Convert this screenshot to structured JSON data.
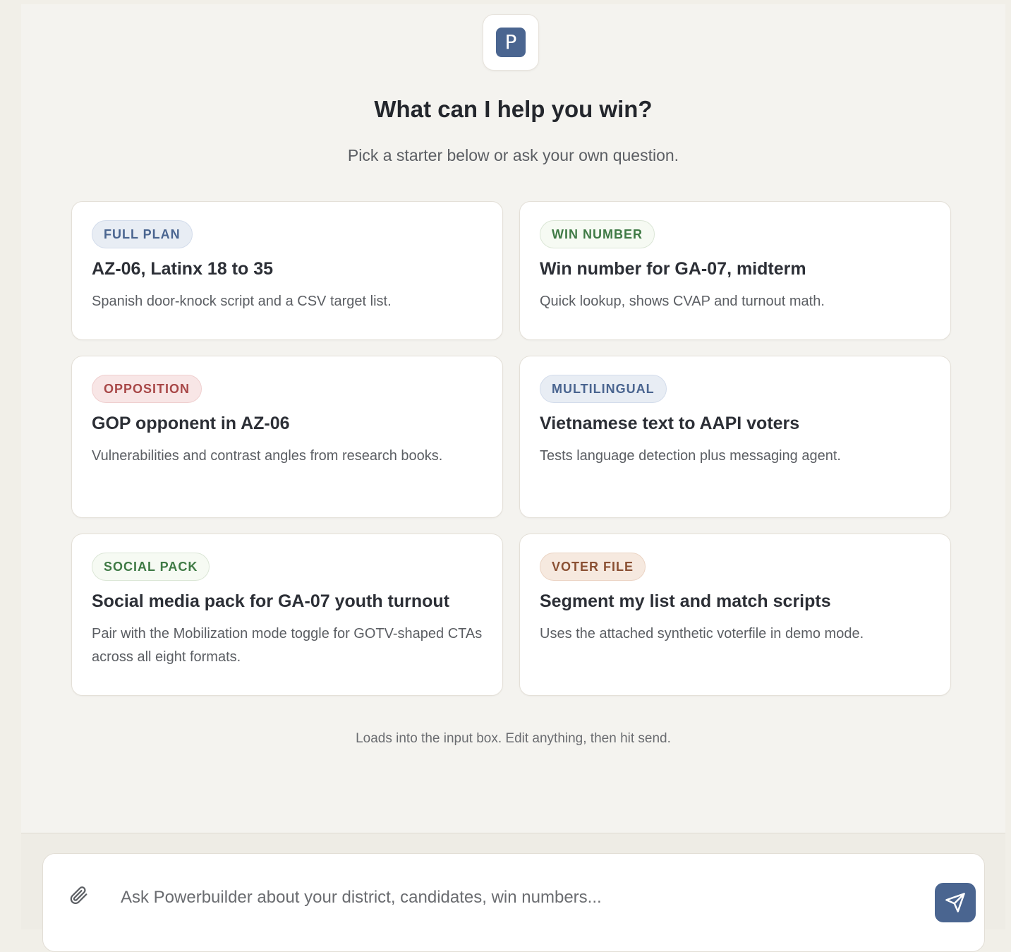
{
  "logo": {
    "letter": "P"
  },
  "hero": {
    "title": "What can I help you win?",
    "subtitle": "Pick a starter below or ask your own question."
  },
  "starters": [
    {
      "tag": "FULL PLAN",
      "tag_color": "#4a6590",
      "title": "AZ-06, Latinx 18 to 35",
      "description": "Spanish door-knock script and a CSV target list."
    },
    {
      "tag": "WIN NUMBER",
      "tag_color": "#3f7a45",
      "title": "Win number for GA-07, midterm",
      "description": "Quick lookup, shows CVAP and turnout math."
    },
    {
      "tag": "OPPOSITION",
      "tag_color": "#a84848",
      "title": "GOP opponent in AZ-06",
      "description": "Vulnerabilities and contrast angles from research books."
    },
    {
      "tag": "MULTILINGUAL",
      "tag_color": "#4a6590",
      "title": "Vietnamese text to AAPI voters",
      "description": "Tests language detection plus messaging agent."
    },
    {
      "tag": "SOCIAL PACK",
      "tag_color": "#3f7a45",
      "title": "Social media pack for GA-07 youth turnout",
      "description": "Pair with the Mobilization mode toggle for GOTV-shaped CTAs across all eight formats."
    },
    {
      "tag": "VOTER FILE",
      "tag_color": "#8a5033",
      "title": "Segment my list and match scripts",
      "description": "Uses the attached synthetic voterfile in demo mode."
    }
  ],
  "footnote": "Loads into the input box. Edit anything, then hit send.",
  "composer": {
    "placeholder": "Ask Powerbuilder about your district, candidates, win numbers...",
    "value": "",
    "attach_icon": "paperclip-icon",
    "send_icon": "send-icon"
  },
  "colors": {
    "accent": "#4a6590",
    "background": "#f4f3ef"
  }
}
